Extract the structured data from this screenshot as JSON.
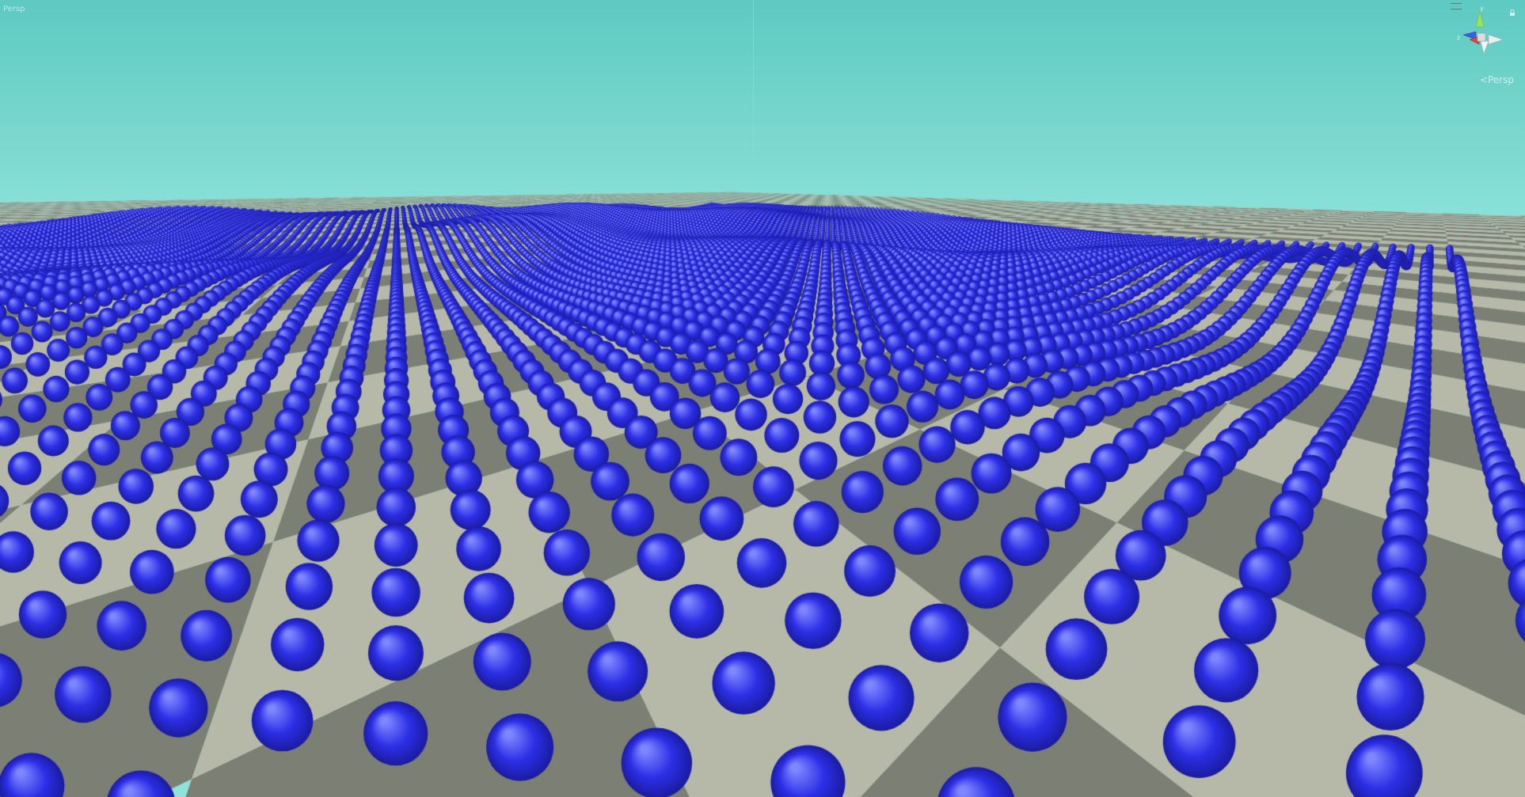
{
  "view": {
    "persp_label": "<Persp",
    "small_corner_label": "Persp"
  },
  "gizmo": {
    "axis_y": "y",
    "axis_z": "z",
    "axis_x": "x",
    "icon": "orientation-gizmo-icon",
    "menu_icon": "hamburger-icon",
    "lock_icon": "lock-icon"
  },
  "colors": {
    "sky_top": "#5ecac2",
    "sky_horizon": "#8fe3da",
    "sphere": "#2d2fe6",
    "floor_light": "#b7b9a8",
    "floor_dark": "#7c7f74",
    "axis_y": "#9be25a",
    "axis_x": "#e04040",
    "axis_z": "#3a5fe0"
  }
}
